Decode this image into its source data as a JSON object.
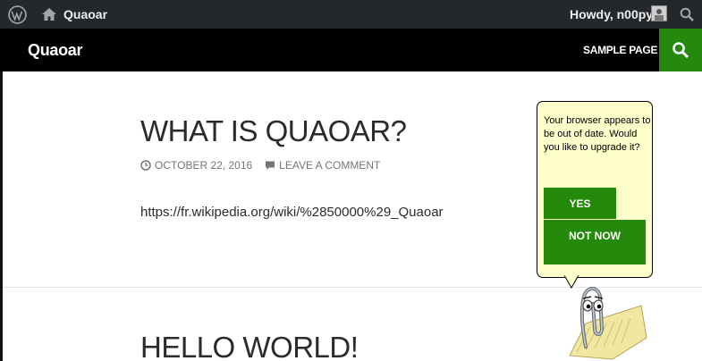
{
  "admin_bar": {
    "site_name": "Quaoar",
    "greeting": "Howdy, n00py",
    "bg_color": "#23282d"
  },
  "header": {
    "site_title": "Quaoar",
    "nav": [
      "SAMPLE PAGE"
    ],
    "search_color": "#24890d"
  },
  "posts": [
    {
      "title": "WHAT IS QUAOAR?",
      "date": "OCTOBER 22, 2016",
      "comment_link": "LEAVE A COMMENT",
      "content": "https://fr.wikipedia.org/wiki/%2850000%29_Quaoar"
    },
    {
      "title": "HELLO WORLD!"
    }
  ],
  "clippy": {
    "message": "Your browser appears to be out of date. Would you like to upgrade it?",
    "yes_label": "YES",
    "no_label": "NOT NOW",
    "bubble_color": "#ffffcc",
    "button_color": "#258a0b"
  }
}
